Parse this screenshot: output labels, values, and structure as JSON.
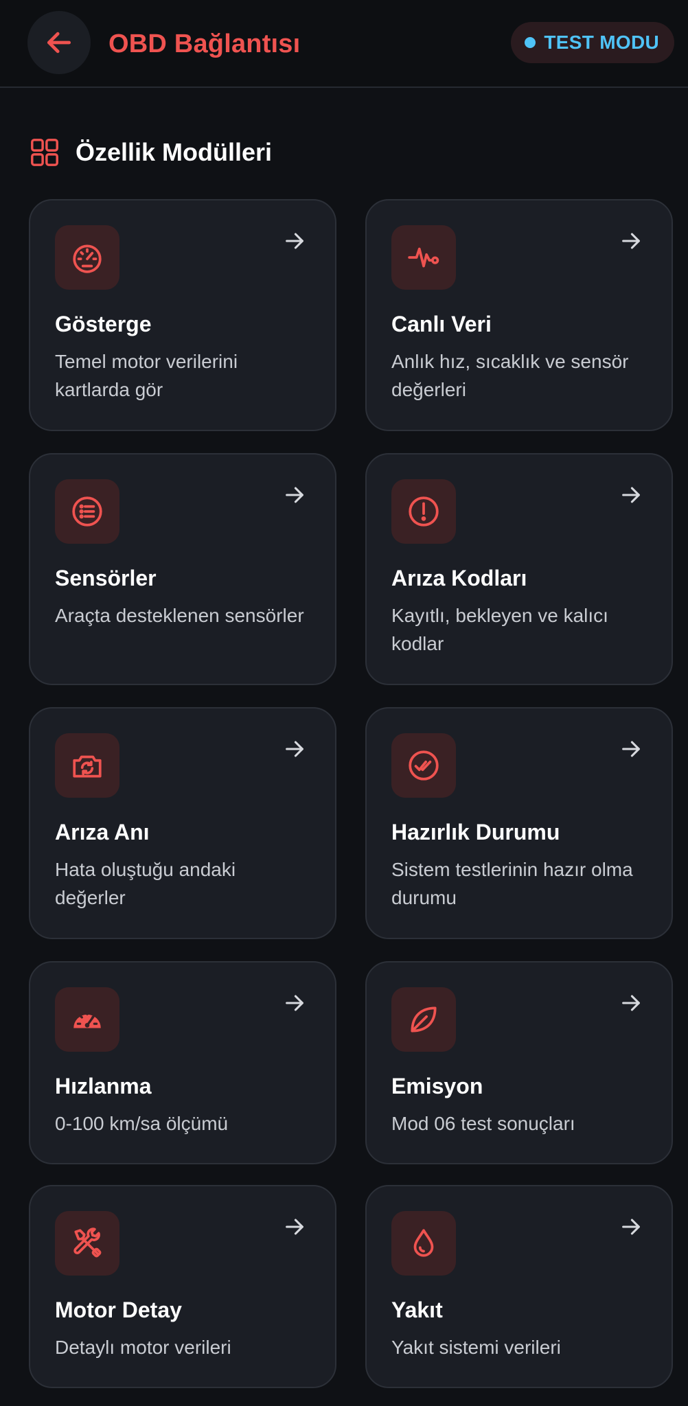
{
  "header": {
    "title": "OBD Bağlantısı",
    "back_icon": "arrow-left-icon",
    "badge_label": "TEST MODU"
  },
  "section": {
    "title": "Özellik Modülleri",
    "icon": "grid-icon"
  },
  "colors": {
    "accent": "#ef5350",
    "badge_text": "#4fc3f7",
    "background": "#0f1115",
    "card": "#1b1e25"
  },
  "modules": [
    {
      "title": "Gösterge",
      "desc": "Temel motor verilerini kartlarda gör",
      "icon": "gauge-icon"
    },
    {
      "title": "Canlı Veri",
      "desc": "Anlık hız, sıcaklık ve sensör değerleri",
      "icon": "pulse-icon"
    },
    {
      "title": "Sensörler",
      "desc": "Araçta desteklenen sensörler",
      "icon": "list-icon"
    },
    {
      "title": "Arıza Kodları",
      "desc": "Kayıtlı, bekleyen ve kalıcı kodlar",
      "icon": "alert-icon"
    },
    {
      "title": "Arıza Anı",
      "desc": "Hata oluştuğu andaki değerler",
      "icon": "camera-icon"
    },
    {
      "title": "Hazırlık Durumu",
      "desc": "Sistem testlerinin hazır olma durumu",
      "icon": "check-circle-icon"
    },
    {
      "title": "Hızlanma",
      "desc": "0-100 km/sa ölçümü",
      "icon": "speedometer-icon"
    },
    {
      "title": "Emisyon",
      "desc": "Mod 06 test sonuçları",
      "icon": "leaf-icon"
    },
    {
      "title": "Motor Detay",
      "desc": "Detaylı motor verileri",
      "icon": "tools-icon"
    },
    {
      "title": "Yakıt",
      "desc": "Yakıt sistemi verileri",
      "icon": "drop-icon"
    }
  ]
}
